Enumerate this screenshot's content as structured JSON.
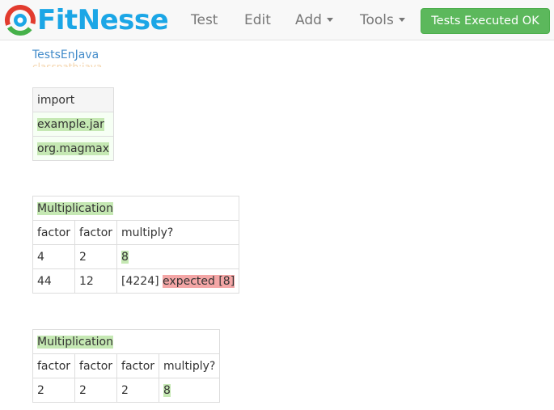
{
  "brand": {
    "name": "FitNesse"
  },
  "nav": {
    "test": "Test",
    "edit": "Edit",
    "add": "Add",
    "tools": "Tools",
    "status": "Tests Executed OK"
  },
  "breadcrumb": {
    "current": "TestsEnJava",
    "subtext": "classpath:java"
  },
  "import_table": {
    "header": "import",
    "rows": [
      "example.jar",
      "org.magmax"
    ]
  },
  "table1": {
    "title": "Multiplication",
    "headers": [
      "factor",
      "factor",
      "multiply?"
    ],
    "rows": [
      {
        "a": "4",
        "b": "2",
        "result": "8"
      },
      {
        "a": "44",
        "b": "12",
        "actual": "[4224]",
        "expected": "expected [8]"
      }
    ]
  },
  "table2": {
    "title": "Multiplication",
    "headers": [
      "factor",
      "factor",
      "factor",
      "multiply?"
    ],
    "rows": [
      {
        "a": "2",
        "b": "2",
        "c": "2",
        "result": "8"
      }
    ]
  },
  "colors": {
    "link": "#428bca",
    "success": "#5cb85c",
    "pass": "#c5e8b3",
    "fail": "#f4a6a6",
    "brand": "#1ba6e6"
  }
}
